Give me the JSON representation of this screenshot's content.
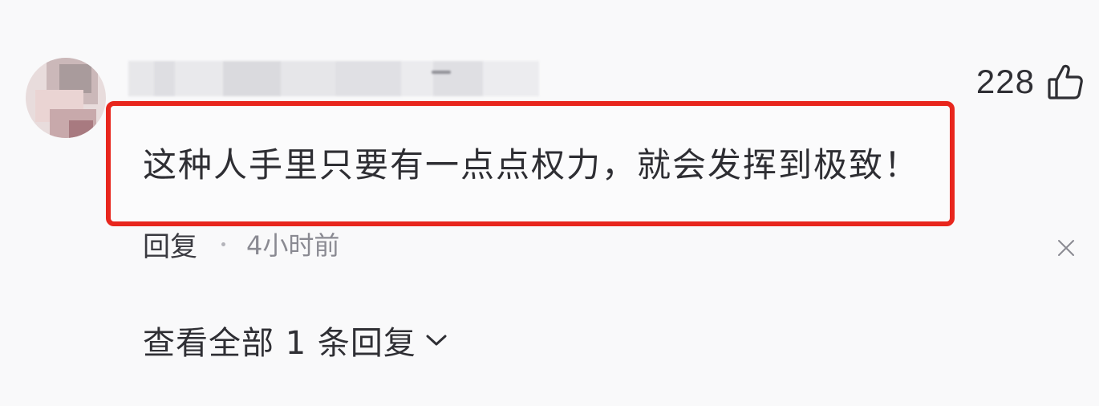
{
  "comment": {
    "like_count": "228",
    "text": "这种人手里只要有一点点权力，就会发挥到极致！",
    "reply_label": "回复",
    "time_ago": "4小时前",
    "view_replies_label": "查看全部 1 条回复"
  },
  "icons": {
    "like": "thumbs-up-icon",
    "dismiss": "close-icon",
    "expand": "chevron-down-icon"
  },
  "colors": {
    "highlight_border": "#e8261d",
    "text": "#2f2f34",
    "muted_text": "#8a8a92",
    "background": "#f9f9fa"
  }
}
